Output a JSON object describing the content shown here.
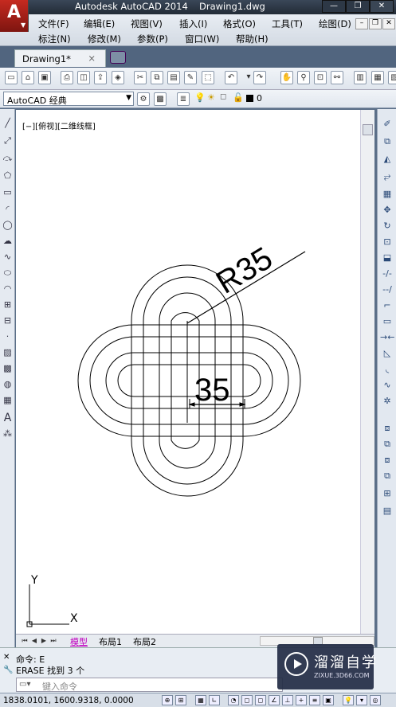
{
  "titlebar": {
    "app_title": "Autodesk AutoCAD 2014",
    "file_name": "Drawing1.dwg",
    "logo_letter": "A"
  },
  "menu": {
    "row1": [
      "文件(F)",
      "编辑(E)",
      "视图(V)",
      "插入(I)",
      "格式(O)",
      "工具(T)",
      "绘图(D)"
    ],
    "row2": [
      "标注(N)",
      "修改(M)",
      "参数(P)",
      "窗口(W)",
      "帮助(H)"
    ]
  },
  "tabs": {
    "active": "Drawing1*",
    "close_glyph": "×"
  },
  "toolbar2": {
    "workspace": "AutoCAD 经典",
    "layer": "0"
  },
  "canvas": {
    "viewport_label": "[−][俯视][二维线框]",
    "dimension_radius": "R35",
    "dimension_linear": "35",
    "ucs_x": "X",
    "ucs_y": "Y"
  },
  "layout_tabs": [
    "模型",
    "布局1",
    "布局2"
  ],
  "command": {
    "history1": "命令:  E",
    "history2": "ERASE  找到  3  个",
    "placeholder": "键入命令"
  },
  "status": {
    "coords": "1838.0101,  1600.9318,  0.0000"
  },
  "watermark": {
    "name": "溜溜自学",
    "url": "ZIXUE.3D66.COM"
  },
  "colors": {
    "accent": "#c62a20",
    "model_tab": "#c000c0",
    "window_dark": "#2a3441"
  }
}
